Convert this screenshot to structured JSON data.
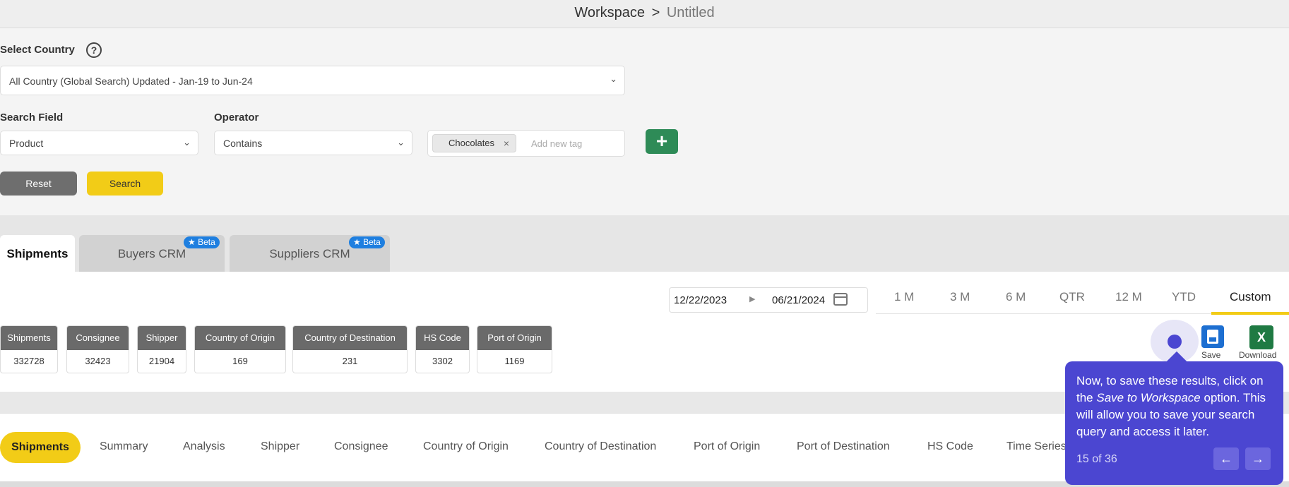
{
  "header": {
    "workspace": "Workspace",
    "separator": ">",
    "current": "Untitled"
  },
  "form": {
    "country_label": "Select Country",
    "country_value": "All Country (Global Search) Updated - Jan-19 to Jun-24",
    "search_field_label": "Search Field",
    "search_field_value": "Product",
    "operator_label": "Operator",
    "operator_value": "Contains",
    "tag": "Chocolates",
    "tag_placeholder": "Add new tag",
    "reset_label": "Reset",
    "search_label": "Search",
    "help_glyph": "?",
    "plus_glyph": "+"
  },
  "tabs": [
    {
      "label": "Shipments"
    },
    {
      "label": "Buyers CRM",
      "badge": "★ Beta"
    },
    {
      "label": "Suppliers CRM",
      "badge": "★ Beta"
    }
  ],
  "date_range": {
    "from": "12/22/2023",
    "to": "06/21/2024"
  },
  "periods": [
    "1 M",
    "3 M",
    "6 M",
    "QTR",
    "12 M",
    "YTD",
    "Custom"
  ],
  "stats": [
    {
      "label": "Shipments",
      "value": "332728"
    },
    {
      "label": "Consignee",
      "value": "32423"
    },
    {
      "label": "Shipper",
      "value": "21904"
    },
    {
      "label": "Country of Origin",
      "value": "169"
    },
    {
      "label": "Country of Destination",
      "value": "231"
    },
    {
      "label": "HS Code",
      "value": "3302"
    },
    {
      "label": "Port of Origin",
      "value": "1169"
    }
  ],
  "actions": {
    "save_label": "Save",
    "download_label": "Download"
  },
  "nav": [
    "Shipments",
    "Summary",
    "Analysis",
    "Shipper",
    "Consignee",
    "Country of Origin",
    "Country of Destination",
    "Port of Origin",
    "Port of Destination",
    "HS Code",
    "Time Series"
  ],
  "tooltip": {
    "text_before": "Now, to save these results, click on the ",
    "text_em": "Save to Workspace",
    "text_after": " option. This will allow you to save your search query and access it later.",
    "step": "15 of 36",
    "prev_glyph": "←",
    "next_glyph": "→"
  },
  "colors": {
    "accent": "#f2cc17",
    "tooltip": "#4b46d1",
    "beta": "#1e7fe0",
    "add": "#2e8b57"
  }
}
